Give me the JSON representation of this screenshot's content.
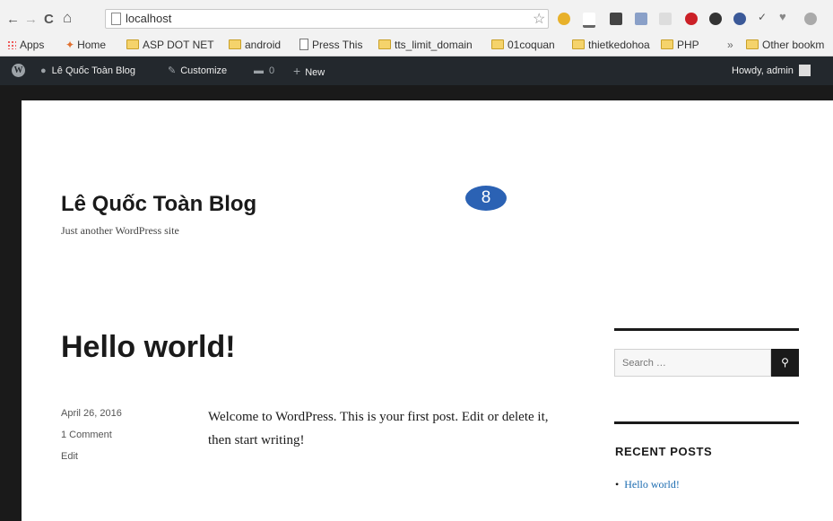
{
  "browser": {
    "nav": {
      "back": "←",
      "forward": "→",
      "reload": "C",
      "home": "⌂"
    },
    "url": "localhost",
    "bookmarks": [
      {
        "label": "Apps",
        "icon": "apps-grid-icon"
      },
      {
        "label": "Home",
        "icon": "home-bookmark-icon"
      },
      {
        "label": "ASP DOT NET",
        "icon": "folder-icon"
      },
      {
        "label": "android",
        "icon": "folder-icon"
      },
      {
        "label": "Press This",
        "icon": "page-icon"
      },
      {
        "label": "tts_limit_domain",
        "icon": "folder-icon"
      },
      {
        "label": "01coquan",
        "icon": "folder-icon"
      },
      {
        "label": "thietkedohoa",
        "icon": "folder-icon"
      },
      {
        "label": "PHP",
        "icon": "folder-icon"
      }
    ],
    "overflow": "»",
    "other_bookmarks": "Other bookm"
  },
  "adminbar": {
    "site_name": "Lê Quốc Toàn Blog",
    "customize": "Customize",
    "comments_count": "0",
    "new": "New",
    "howdy": "Howdy, admin"
  },
  "site": {
    "title": "Lê Quốc Toàn Blog",
    "description": "Just another WordPress site",
    "badge": "8"
  },
  "post": {
    "title": "Hello world!",
    "date": "April 26, 2016",
    "comments": "1 Comment",
    "edit": "Edit",
    "content": "Welcome to WordPress. This is your first post. Edit or delete it, then start writing!"
  },
  "sidebar": {
    "search_placeholder": "Search …",
    "recent_posts_title": "RECENT POSTS",
    "recent_posts": [
      "Hello world!"
    ]
  },
  "colors": {
    "adminbar": "#23282d",
    "frame": "#1a1a1a",
    "link": "#1a6bb0",
    "badge": "#2b62b4"
  }
}
